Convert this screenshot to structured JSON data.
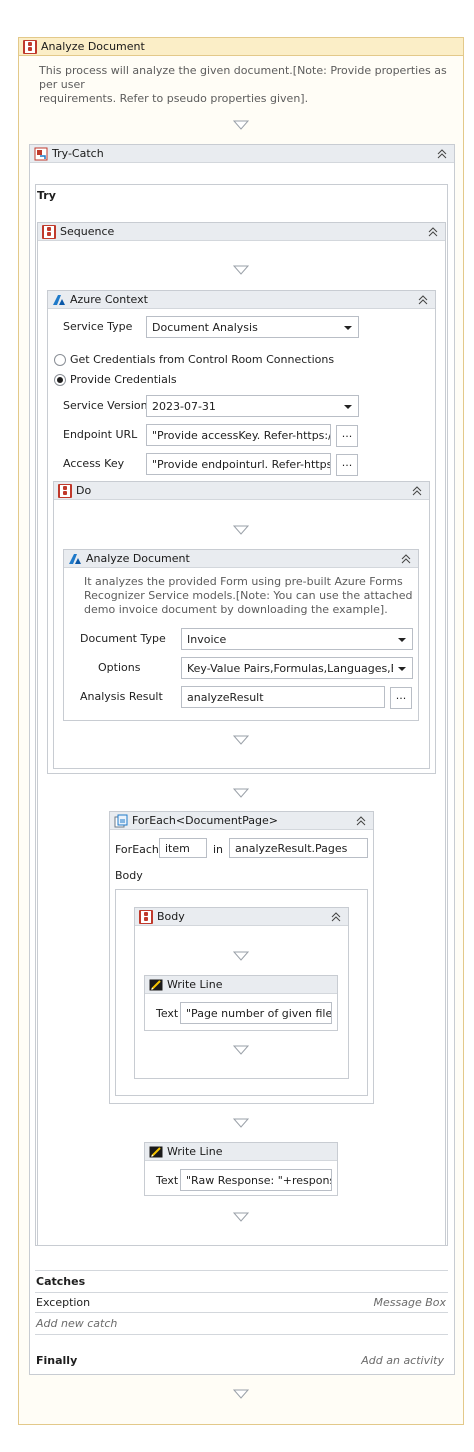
{
  "root": {
    "title": "Analyze Document",
    "description_line1": "This process will analyze the given document.[Note: Provide properties as per user",
    "description_line2": "requirements. Refer to pseudo properties given]."
  },
  "trycatch": {
    "title": "Try-Catch",
    "try_label": "Try",
    "catches_label": "Catches",
    "exception_label": "Exception",
    "exception_handler": "Message Box",
    "add_catch": "Add new catch",
    "finally_label": "Finally",
    "finally_placeholder": "Add an activity"
  },
  "sequence": {
    "title": "Sequence"
  },
  "azure_context": {
    "title": "Azure Context",
    "service_type_label": "Service Type",
    "service_type_value": "Document Analysis",
    "radio_control_room": "Get Credentials from Control Room Connections",
    "radio_provide": "Provide Credentials",
    "service_version_label": "Service Version",
    "service_version_value": "2023-07-31",
    "endpoint_label": "Endpoint URL",
    "endpoint_value": "\"Provide accessKey. Refer-https://dc",
    "access_key_label": "Access Key",
    "access_key_value": "\"Provide endpointurl. Refer-https://",
    "ellipsis": "..."
  },
  "do_block": {
    "title": "Do"
  },
  "analyze": {
    "title": "Analyze Document",
    "desc_line1": "It analyzes the provided Form using pre-built Azure Forms",
    "desc_line2": "Recognizer Service models.[Note: You can use the attached",
    "desc_line3": "demo invoice document by downloading the example].",
    "doc_type_label": "Document Type",
    "doc_type_value": "Invoice",
    "options_label": "Options",
    "options_value": "Key-Value Pairs,Formulas,Languages,Barcc",
    "result_label": "Analysis Result",
    "result_value": "analyzeResult",
    "ellipsis": "..."
  },
  "foreach": {
    "title": "ForEach<DocumentPage>",
    "foreach_label": "ForEach",
    "item_value": "item",
    "in_label": "in",
    "collection_value": "analyzeResult.Pages",
    "body_label": "Body"
  },
  "body_seq": {
    "title": "Body"
  },
  "writeline1": {
    "title": "Write Line",
    "text_label": "Text",
    "text_value": "\"Page number of  given file is"
  },
  "writeline2": {
    "title": "Write Line",
    "text_label": "Text",
    "text_value": "\"Raw Response:  \"+response"
  },
  "colors": {
    "accent": "#1f7ac9",
    "sequence_red": "#c0392b",
    "header_bg": "#e9ecf0",
    "root_header": "#fbeec7"
  }
}
